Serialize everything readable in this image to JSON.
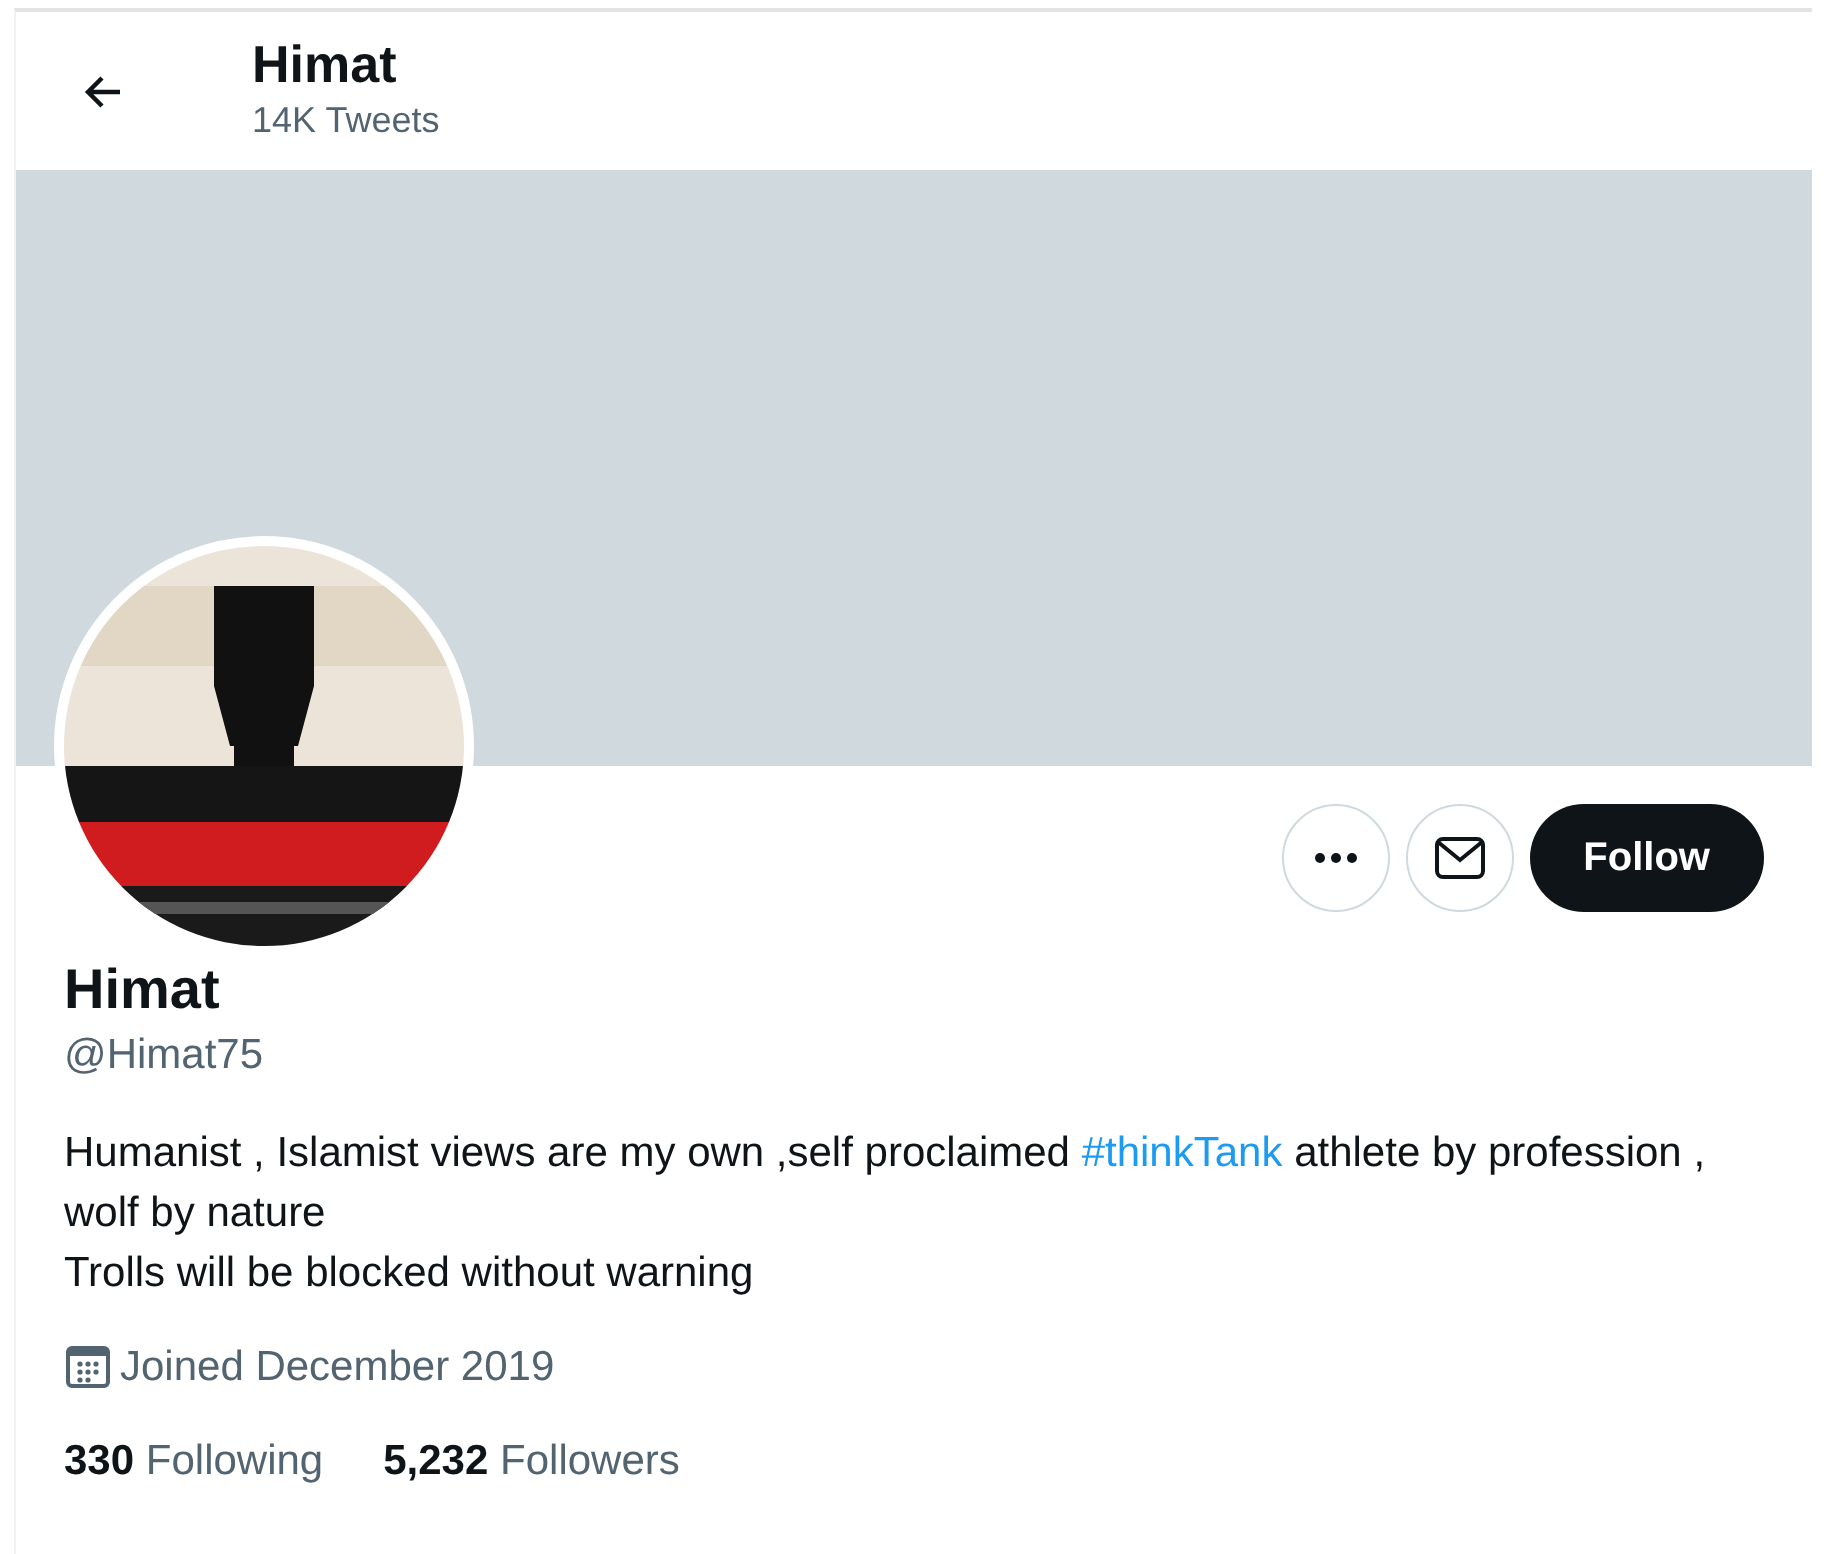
{
  "header": {
    "title": "Himat",
    "subtitle": "14K Tweets"
  },
  "profile": {
    "name": "Himat",
    "handle": "@Himat75",
    "bio": [
      {
        "kind": "text",
        "text": "Humanist , Islamist views are my own ,self proclaimed "
      },
      {
        "kind": "link",
        "text": "#thinkTank"
      },
      {
        "kind": "text",
        "text": " athlete by profession , wolf by nature"
      },
      {
        "kind": "break"
      },
      {
        "kind": "text",
        "text": "Trolls will be blocked without warning"
      }
    ],
    "joined": "Joined December 2019",
    "stats": [
      {
        "count": "330",
        "label": "Following"
      },
      {
        "count": "5,232",
        "label": "Followers"
      }
    ]
  },
  "actions": {
    "follow": "Follow"
  }
}
